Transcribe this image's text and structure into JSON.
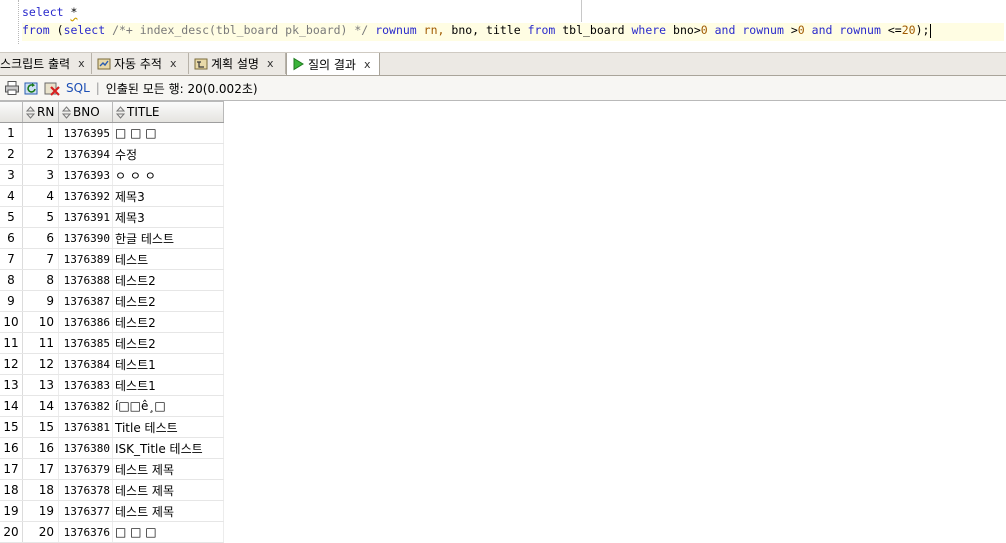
{
  "editor": {
    "line1": {
      "kw_select": "select",
      "star": "*"
    },
    "line2": {
      "kw_from": "from",
      "open_paren": "(",
      "kw_select": "select",
      "comment": "/*+ index_desc(tbl_board pk_board) */",
      "c1": "rownum",
      "a1": "rn,",
      "c2": "bno,",
      "c3": "title",
      "kw_from2": "from",
      "table": "tbl_board",
      "kw_where": "where",
      "cond1": "bno>",
      "n0a": "0",
      "and1": "and",
      "rownum1": "rownum",
      "gt": ">",
      "n0b": "0",
      "and2": "and",
      "rownum2": "rownum",
      "le": "<=",
      "n20": "20",
      "tail": ");"
    }
  },
  "tabs": [
    {
      "label": "스크립트 출력",
      "close": "x",
      "icon": ""
    },
    {
      "label": "자동 추적",
      "close": "x",
      "icon": "autotrace-icon"
    },
    {
      "label": "계획 설명",
      "close": "x",
      "icon": "explain-plan-icon"
    },
    {
      "label": "질의 결과",
      "close": "x",
      "icon": "run-icon",
      "active": true
    }
  ],
  "toolbar": {
    "sql_label": "SQL",
    "separator": "|",
    "status": "인출된 모든 행: 20(0.002초)"
  },
  "grid": {
    "columns": [
      "RN",
      "BNO",
      "TITLE"
    ],
    "rows": [
      {
        "n": "1",
        "rn": "1",
        "bno": "1376395",
        "title": "□ □ □"
      },
      {
        "n": "2",
        "rn": "2",
        "bno": "1376394",
        "title": "수정"
      },
      {
        "n": "3",
        "rn": "3",
        "bno": "1376393",
        "title": "ㅇ ㅇ ㅇ"
      },
      {
        "n": "4",
        "rn": "4",
        "bno": "1376392",
        "title": "제목3"
      },
      {
        "n": "5",
        "rn": "5",
        "bno": "1376391",
        "title": "제목3"
      },
      {
        "n": "6",
        "rn": "6",
        "bno": "1376390",
        "title": "한글 테스트"
      },
      {
        "n": "7",
        "rn": "7",
        "bno": "1376389",
        "title": "테스트"
      },
      {
        "n": "8",
        "rn": "8",
        "bno": "1376388",
        "title": "테스트2"
      },
      {
        "n": "9",
        "rn": "9",
        "bno": "1376387",
        "title": "테스트2"
      },
      {
        "n": "10",
        "rn": "10",
        "bno": "1376386",
        "title": "테스트2"
      },
      {
        "n": "11",
        "rn": "11",
        "bno": "1376385",
        "title": "테스트2"
      },
      {
        "n": "12",
        "rn": "12",
        "bno": "1376384",
        "title": "테스트1"
      },
      {
        "n": "13",
        "rn": "13",
        "bno": "1376383",
        "title": "테스트1"
      },
      {
        "n": "14",
        "rn": "14",
        "bno": "1376382",
        "title": "í□□ê¸□"
      },
      {
        "n": "15",
        "rn": "15",
        "bno": "1376381",
        "title": "Title 테스트"
      },
      {
        "n": "16",
        "rn": "16",
        "bno": "1376380",
        "title": "ISK_Title 테스트"
      },
      {
        "n": "17",
        "rn": "17",
        "bno": "1376379",
        "title": "테스트 제목"
      },
      {
        "n": "18",
        "rn": "18",
        "bno": "1376378",
        "title": "테스트 제목"
      },
      {
        "n": "19",
        "rn": "19",
        "bno": "1376377",
        "title": "테스트 제목"
      },
      {
        "n": "20",
        "rn": "20",
        "bno": "1376376",
        "title": "□ □ □"
      }
    ]
  }
}
